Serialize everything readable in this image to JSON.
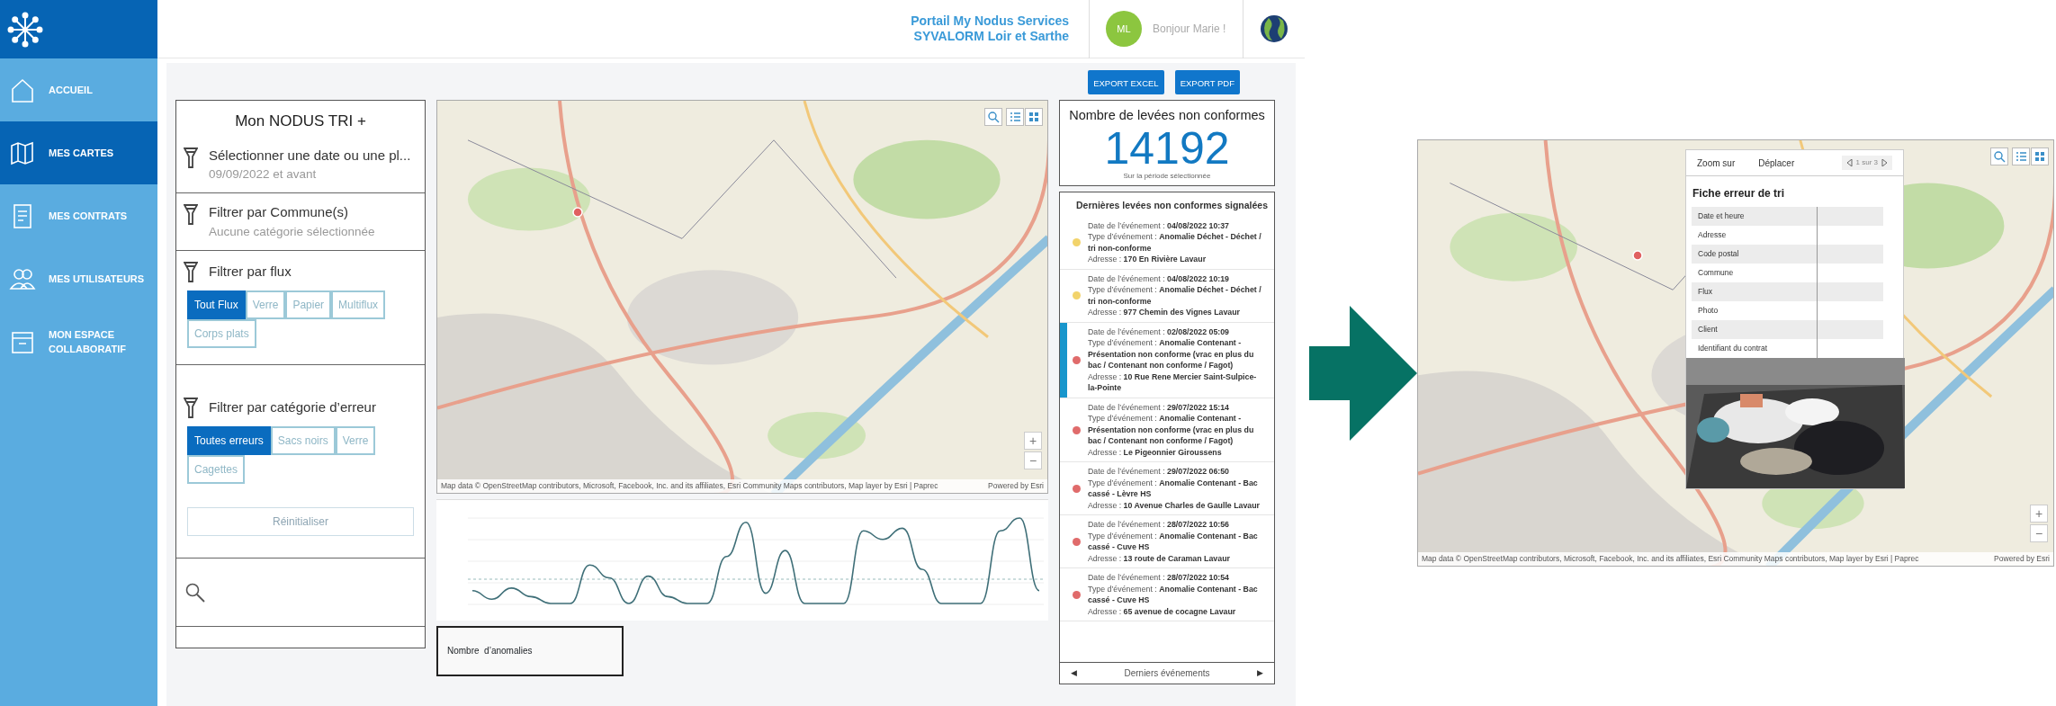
{
  "sidebar": {
    "items": [
      {
        "label": "ACCUEIL",
        "selected": false
      },
      {
        "label": "MES CARTES",
        "selected": true
      },
      {
        "label": "MES CONTRATS",
        "selected": false
      },
      {
        "label": "MES UTILISATEURS",
        "selected": false
      },
      {
        "label": "MON ESPACE COLLABORATIF",
        "selected": false
      }
    ]
  },
  "header": {
    "portal_lines": [
      "Portail My Nodus Services",
      "SYVALORM Loir et Sarthe"
    ],
    "avatar_initials": "ML",
    "greeting": "Bonjour Marie !"
  },
  "toolbar": {
    "buttons": [
      "EXPORT EXCEL",
      "EXPORT PDF"
    ]
  },
  "filters": {
    "title": "Mon NODUS TRI +",
    "sections": [
      {
        "title": "Sélectionner une date ou une pl...",
        "subtitle": "09/09/2022 et avant"
      },
      {
        "title": "Filtrer par Commune(s)",
        "subtitle": "Aucune catégorie sélectionnée"
      }
    ],
    "flux": {
      "title": "Filtrer par flux",
      "options": [
        {
          "label": "Tout Flux",
          "selected": true
        },
        {
          "label": "Verre",
          "selected": false
        },
        {
          "label": "Papier",
          "selected": false
        },
        {
          "label": "Multiflux",
          "selected": false
        },
        {
          "label": "Corps plats",
          "selected": false
        }
      ]
    },
    "error_category": {
      "title": "Filtrer par catégorie d’erreur",
      "options": [
        {
          "label": "Toutes erreurs",
          "selected": true
        },
        {
          "label": "Sacs noirs",
          "selected": false
        },
        {
          "label": "Verre",
          "selected": false
        },
        {
          "label": "Cagettes",
          "selected": false
        }
      ]
    },
    "reset_button": {
      "label": "Réinitialiser",
      "disabled": true
    }
  },
  "map": {
    "zoom_controls": [
      "+",
      "−"
    ],
    "attribution": "Map data © OpenStreetMap contributors, Microsoft, Facebook, Inc. and its affiliates, Esri Community Maps contributors, Map layer by Esri | Paprec",
    "powered_by": "Powered by Esri"
  },
  "chart": {
    "label": "Nombre  d’anomalies"
  },
  "count": {
    "title": "Nombre de levées non conformes",
    "value": "14192",
    "caption": "Sur la période sélectionnée"
  },
  "events": {
    "title": "Dernières levées non conformes signalées",
    "footer": "Derniers événements",
    "prev": "◀",
    "next": "▶",
    "items": [
      {
        "color": "#f2d36b",
        "selected": false,
        "lines": [
          {
            "label": "Date de l’événement : ",
            "value": "04/08/2022 10:37"
          },
          {
            "label": "Type d’événement : ",
            "value": "Anomalie Déchet - Déchet / tri non-conforme"
          },
          {
            "label": "Adresse : ",
            "value": "170 En Rivière Lavaur"
          }
        ]
      },
      {
        "color": "#f2d36b",
        "selected": false,
        "lines": [
          {
            "label": "Date de l’événement : ",
            "value": "04/08/2022 10:19"
          },
          {
            "label": "Type d’événement : ",
            "value": "Anomalie Déchet - Déchet / tri non-conforme"
          },
          {
            "label": "Adresse : ",
            "value": "977 Chemin des Vignes Lavaur"
          }
        ]
      },
      {
        "color": "#e06b6b",
        "selected": true,
        "lines": [
          {
            "label": "Date de l’événement : ",
            "value": "02/08/2022 05:09"
          },
          {
            "label": "Type d’événement : ",
            "value": "Anomalie Contenant - Présentation non conforme (vrac en plus du bac / Contenant non conforme / Fagot)"
          },
          {
            "label": "Adresse : ",
            "value": "10 Rue Rene Mercier Saint-Sulpice-la-Pointe"
          }
        ]
      },
      {
        "color": "#e06b6b",
        "selected": false,
        "lines": [
          {
            "label": "Date de l’événement : ",
            "value": "29/07/2022 15:14"
          },
          {
            "label": "Type d’événement : ",
            "value": "Anomalie Contenant - Présentation non conforme (vrac en plus du bac / Contenant non conforme / Fagot)"
          },
          {
            "label": "Adresse : ",
            "value": "Le Pigeonnier Giroussens"
          }
        ]
      },
      {
        "color": "#e06b6b",
        "selected": false,
        "lines": [
          {
            "label": "Date de l’événement : ",
            "value": "29/07/2022 06:50"
          },
          {
            "label": "Type d’événement : ",
            "value": "Anomalie Contenant - Bac cassé - Lèvre HS"
          },
          {
            "label": "Adresse : ",
            "value": "10 Avenue Charles de Gaulle Lavaur"
          }
        ]
      },
      {
        "color": "#e06b6b",
        "selected": false,
        "lines": [
          {
            "label": "Date de l’événement : ",
            "value": "28/07/2022 10:56"
          },
          {
            "label": "Type d’événement : ",
            "value": "Anomalie Contenant - Bac cassé - Cuve HS"
          },
          {
            "label": "Adresse : ",
            "value": "13 route de Caraman Lavaur"
          }
        ]
      },
      {
        "color": "#e06b6b",
        "selected": false,
        "lines": [
          {
            "label": "Date de l’événement : ",
            "value": "28/07/2022 10:54"
          },
          {
            "label": "Type d’événement : ",
            "value": "Anomalie Contenant - Bac cassé - Cuve HS"
          },
          {
            "label": "Adresse : ",
            "value": "65 avenue de cocagne Lavaur"
          }
        ]
      }
    ]
  },
  "zoom_map": {
    "zoom_controls": [
      "+",
      "−"
    ],
    "attribution": "Map data © OpenStreetMap contributors, Microsoft, Facebook, Inc. and its affiliates, Esri Community Maps contributors, Map layer by Esri | Paprec",
    "powered_by": "Powered by Esri",
    "popup": {
      "actions": [
        "Zoom sur",
        "Déplacer"
      ],
      "pager": "1 sur 3",
      "title": "Fiche erreur de tri",
      "fields": [
        "Date et heure",
        "Adresse",
        "Code postal",
        "Commune",
        "Flux",
        "Photo",
        "Client",
        "Identifiant du contrat"
      ]
    }
  }
}
